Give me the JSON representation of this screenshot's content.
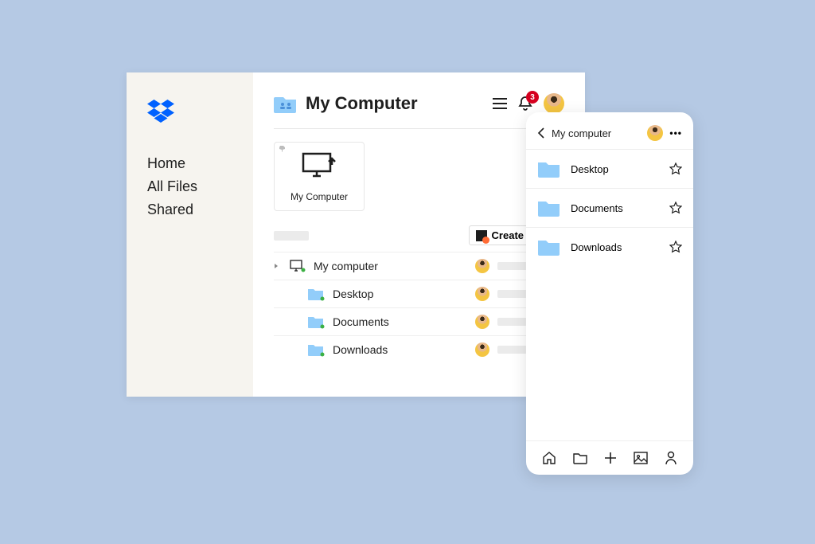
{
  "sidebar": {
    "items": [
      "Home",
      "All Files",
      "Shared"
    ]
  },
  "header": {
    "title": "My Computer",
    "notification_count": "3"
  },
  "card": {
    "label": "My Computer"
  },
  "toolbar": {
    "create_label": "Create"
  },
  "files": {
    "root": "My computer",
    "children": [
      "Desktop",
      "Documents",
      "Downloads"
    ]
  },
  "mobile": {
    "title": "My computer",
    "items": [
      "Desktop",
      "Documents",
      "Downloads"
    ]
  },
  "colors": {
    "folder": "#92cdfa",
    "brand": "#0061ff",
    "accent": "#ff6b35",
    "badge": "#d5001f"
  }
}
